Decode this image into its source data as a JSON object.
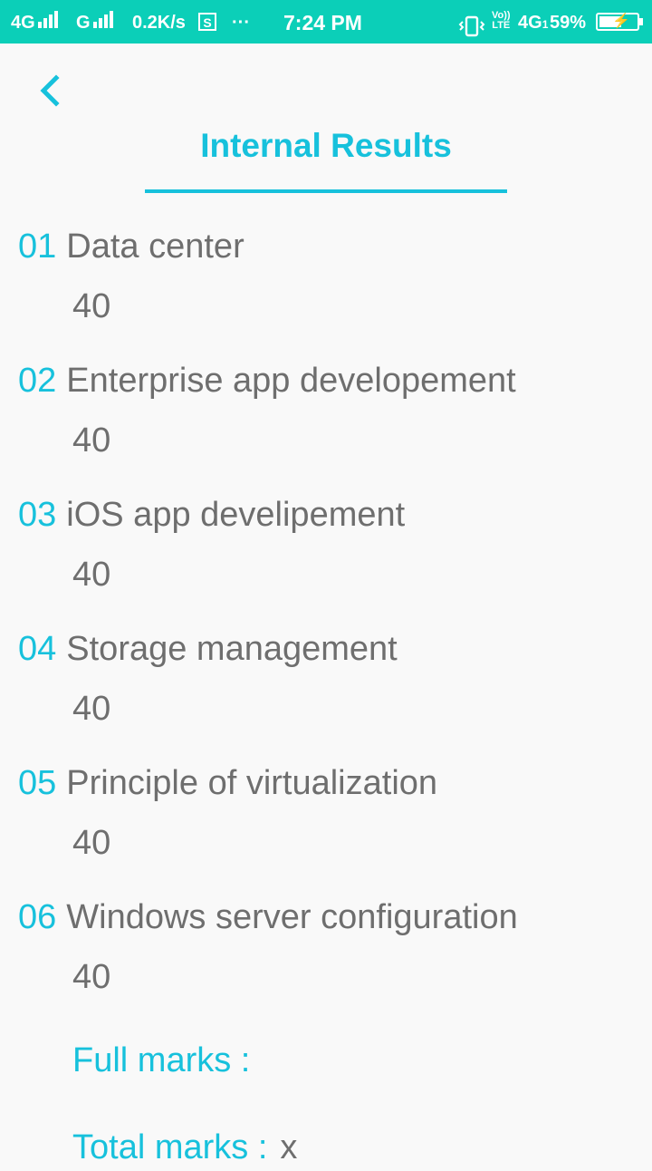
{
  "status_bar": {
    "network_1": "4G",
    "network_2": "G",
    "speed": "0.2K/s",
    "sim_icon": "S",
    "overflow": "···",
    "time": "7:24 PM",
    "vibrate_icon": "vibrate-icon",
    "volte_top": "Vo))",
    "volte_bottom": "LTE",
    "network_3": "4G",
    "network_3_sub": "1",
    "battery_percent": "59%",
    "battery_level": 0.59,
    "accent_color": "#0bcfb8"
  },
  "header": {
    "back_icon": "chevron-left-icon",
    "title": "Internal Results",
    "accent_color": "#17c1dc"
  },
  "subjects": [
    {
      "number": "01",
      "name": "Data center",
      "mark": "40"
    },
    {
      "number": "02",
      "name": "Enterprise app developement",
      "mark": "40"
    },
    {
      "number": "03",
      "name": "iOS app develipement",
      "mark": "40"
    },
    {
      "number": "04",
      "name": "Storage management",
      "mark": "40"
    },
    {
      "number": "05",
      "name": "Principle of virtualization",
      "mark": "40"
    },
    {
      "number": "06",
      "name": "Windows server configuration",
      "mark": "40"
    }
  ],
  "summary": {
    "full_marks_label": "Full marks :",
    "full_marks_value": "",
    "total_marks_label": "Total marks :",
    "total_marks_value": "x"
  }
}
